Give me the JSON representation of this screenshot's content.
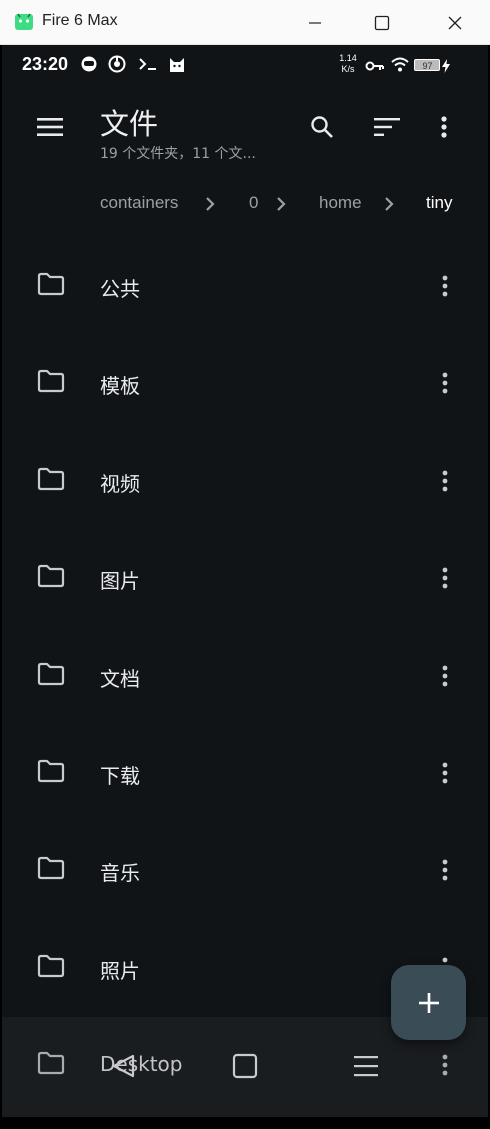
{
  "window": {
    "title": "Fire 6 Max",
    "accent": "#3ddc84"
  },
  "status_bar": {
    "time": "23:20",
    "net_speed_value": "1.14",
    "net_speed_unit": "K/s",
    "battery": "97"
  },
  "app_bar": {
    "title": "文件",
    "subtitle": "19 个文件夹，11 个文..."
  },
  "breadcrumb": [
    "containers",
    "0",
    "home",
    "tiny"
  ],
  "files": [
    {
      "name": "公共"
    },
    {
      "name": "模板"
    },
    {
      "name": "视频"
    },
    {
      "name": "图片"
    },
    {
      "name": "文档"
    },
    {
      "name": "下载"
    },
    {
      "name": "音乐"
    },
    {
      "name": "照片"
    },
    {
      "name": "Desktop"
    }
  ],
  "colors": {
    "background": "#111417",
    "fab": "#3a4d56",
    "text_primary": "#e8eaed",
    "text_secondary": "#9aa0a6"
  }
}
